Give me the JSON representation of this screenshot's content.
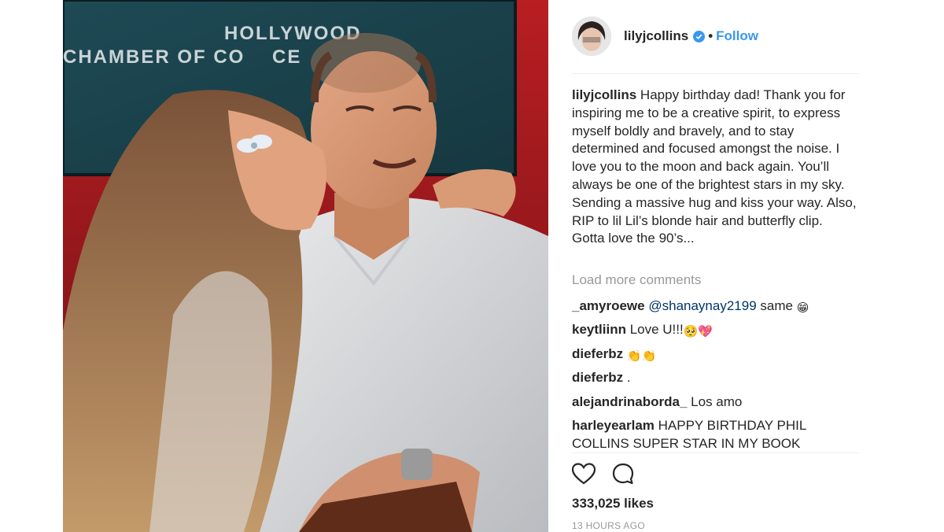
{
  "photo": {
    "sign_line1": "HOLLYWOOD",
    "sign_line2": "CHAMBER OF CO    CE"
  },
  "post": {
    "username": "lilyjcollins",
    "follow_label": "Follow",
    "separator": "•",
    "caption_user": "lilyjcollins",
    "caption_text": " Happy birthday dad! Thank you for inspiring me to be a creative spirit, to express myself boldly and bravely, and to stay determined and focused amongst the noise. I love you to the moon and back again. You’ll always be one of the brightest stars in my sky. Sending a massive hug and kiss your way. Also, RIP to lil Lil’s blonde hair and butterfly clip. Gotta love the 90’s...",
    "load_more": "Load more comments",
    "comments": [
      {
        "user": "_amyroewe",
        "mention": "@shanaynay2199",
        "text": " same ",
        "emoji": "😁"
      },
      {
        "user": "keytliinn",
        "mention": "",
        "text": " Love U!!!",
        "emoji": "🥺💖"
      },
      {
        "user": "dieferbz",
        "mention": "",
        "text": " ",
        "emoji": "👏👏"
      },
      {
        "user": "dieferbz",
        "mention": "",
        "text": " .",
        "emoji": ""
      },
      {
        "user": "alejandrinaborda_",
        "mention": "",
        "text": " Los amo",
        "emoji": ""
      },
      {
        "user": "harleyearlam",
        "mention": "",
        "text": " HAPPY BIRTHDAY PHIL COLLINS SUPER STAR IN MY BOOK",
        "emoji": ""
      }
    ],
    "likes": "333,025 likes",
    "time": "13 HOURS AGO",
    "icons": [
      "heart-icon",
      "comment-icon",
      "verified-badge-icon"
    ],
    "colors": {
      "follow": "#3897f0",
      "mention": "#003569",
      "muted": "#999999",
      "text": "#262626"
    }
  }
}
